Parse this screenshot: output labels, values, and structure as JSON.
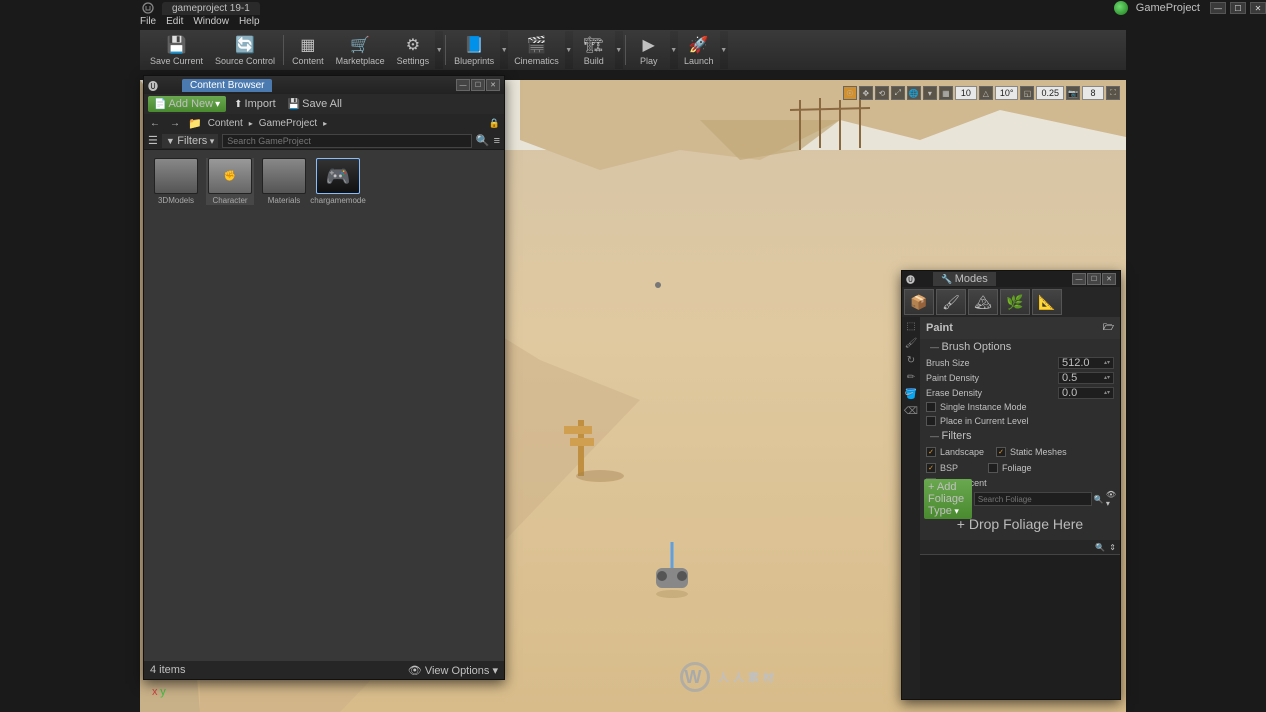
{
  "titleBar": {
    "tab": "gameproject 19-1",
    "projectName": "GameProject"
  },
  "menuBar": [
    "File",
    "Edit",
    "Window",
    "Help"
  ],
  "toolbar": [
    {
      "name": "save-current",
      "label": "Save Current",
      "icon": "💾"
    },
    {
      "name": "source-control",
      "label": "Source Control",
      "icon": "🔄"
    },
    {
      "name": "content",
      "label": "Content",
      "icon": "📁"
    },
    {
      "name": "marketplace",
      "label": "Marketplace",
      "icon": "🛒"
    },
    {
      "name": "settings",
      "label": "Settings",
      "icon": "⚙"
    },
    {
      "name": "blueprints",
      "label": "Blueprints",
      "icon": "📘"
    },
    {
      "name": "cinematics",
      "label": "Cinematics",
      "icon": "🎬"
    },
    {
      "name": "build",
      "label": "Build",
      "icon": "🏗"
    },
    {
      "name": "play",
      "label": "Play",
      "icon": "▶"
    },
    {
      "name": "launch",
      "label": "Launch",
      "icon": "🚀"
    }
  ],
  "viewportBar": {
    "snapPos": "10",
    "snapRot": "10°",
    "snapScale": "0.25",
    "camSpeed": "8"
  },
  "contentBrowser": {
    "tabTitle": "Content Browser",
    "addNew": "Add New",
    "import": "Import",
    "saveAll": "Save All",
    "breadcrumb": [
      "Content",
      "GameProject"
    ],
    "filtersLabel": "Filters",
    "searchPlaceholder": "Search GameProject",
    "items": [
      {
        "label": "3DModels",
        "type": "folder"
      },
      {
        "label": "Character",
        "type": "folder",
        "hover": true
      },
      {
        "label": "Materials",
        "type": "folder"
      },
      {
        "label": "chargamemode",
        "type": "asset",
        "selected": true
      }
    ],
    "statusText": "4 items",
    "viewOptions": "View Options"
  },
  "modesPanel": {
    "tabTitle": "Modes",
    "sectionTitle": "Paint",
    "groupBrush": "Brush Options",
    "brushSize": {
      "label": "Brush Size",
      "value": "512.0"
    },
    "paintDensity": {
      "label": "Paint Density",
      "value": "0.5"
    },
    "eraseDensity": {
      "label": "Erase Density",
      "value": "0.0"
    },
    "singleInstance": {
      "label": "Single Instance Mode",
      "checked": false
    },
    "placeInLevel": {
      "label": "Place in Current Level",
      "checked": false
    },
    "groupFilters": "Filters",
    "landscape": {
      "label": "Landscape",
      "checked": true
    },
    "staticMeshes": {
      "label": "Static Meshes",
      "checked": true
    },
    "bsp": {
      "label": "BSP",
      "checked": true
    },
    "foliage": {
      "label": "Foliage",
      "checked": false
    },
    "translucent": {
      "label": "Translucent",
      "checked": false
    },
    "addFoliageType": "+ Add Foliage Type",
    "searchFoliagePlaceholder": "Search Foliage",
    "dropFoliage": "+ Drop Foliage Here"
  },
  "watermarkText": "人人素材"
}
